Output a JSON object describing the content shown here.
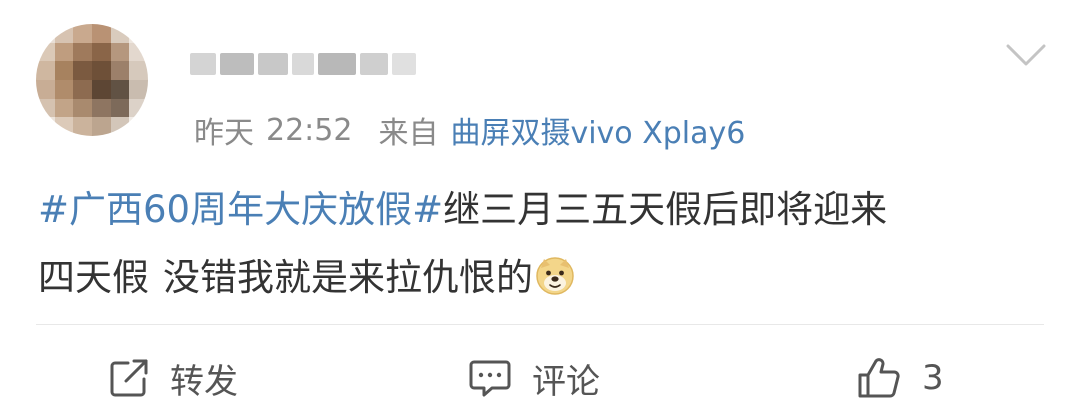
{
  "post": {
    "username": "",
    "time_label": "昨天",
    "time": "22:52",
    "source_prefix": "来自",
    "source_device": "曲屏双摄vivo Xplay6",
    "hashtag": "#广西60周年大庆放假#",
    "text_line1": "继三月三五天假后即将迎来",
    "text_line2a": "四天假",
    "text_line2b": "没错我就是来拉仇恨的"
  },
  "actions": {
    "repost_label": "转发",
    "comment_label": "评论",
    "like_count": "3"
  },
  "icons": {
    "avatar": "avatar-pixelated",
    "menu": "chevron-down-icon",
    "emoji": "doge-emoji-icon",
    "repost": "repost-icon",
    "comment": "comment-icon",
    "like": "thumbs-up-icon"
  },
  "colors": {
    "link": "#4a7fb5",
    "meta": "#8a8a8a",
    "text": "#333333"
  }
}
